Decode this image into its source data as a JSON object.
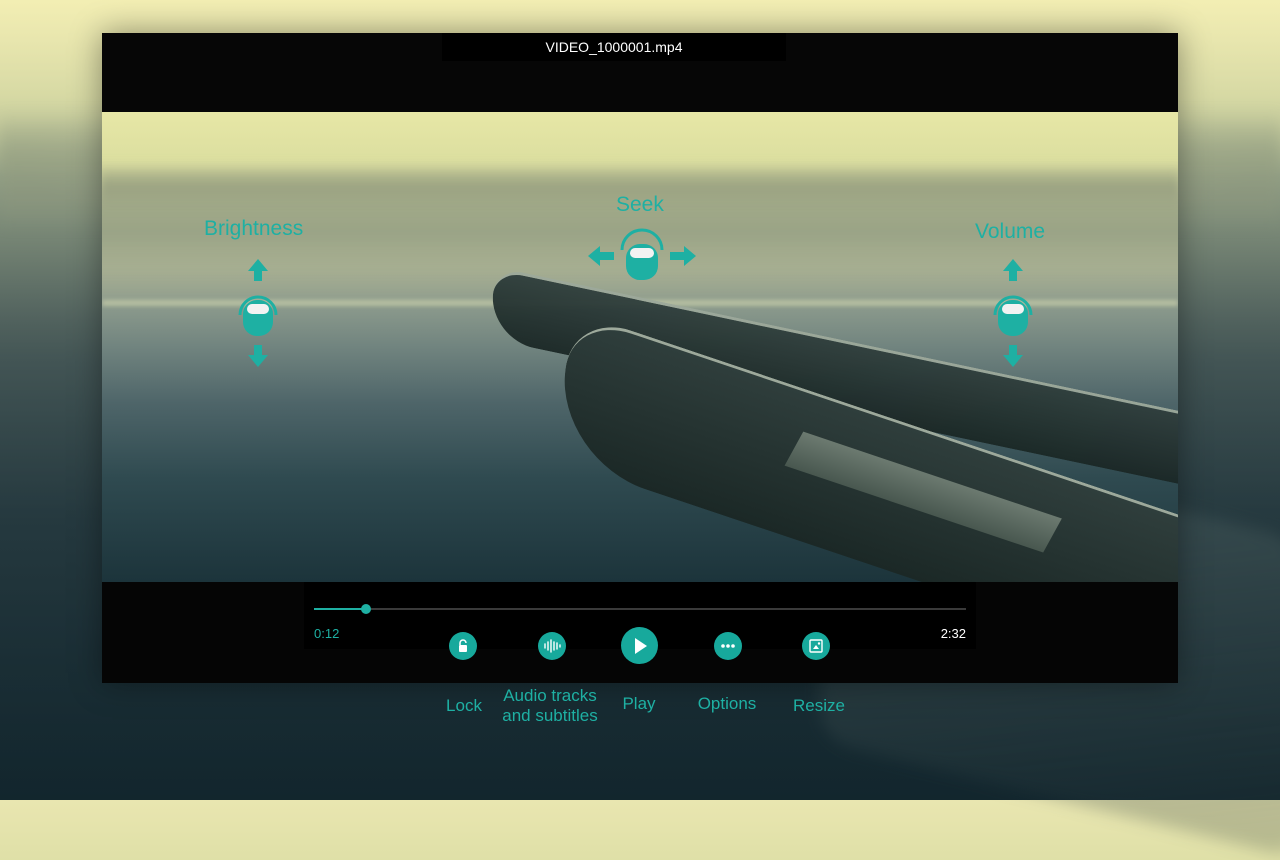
{
  "player": {
    "title": "VIDEO_1000001.mp4"
  },
  "gestures": {
    "brightness": "Brightness",
    "seek": "Seek",
    "volume": "Volume"
  },
  "seekbar": {
    "current_time": "0:12",
    "total_time": "2:32",
    "progress_fraction": 0.08
  },
  "controls": [
    {
      "icon": "lock-icon",
      "caption": "Lock"
    },
    {
      "icon": "audio-waveform-icon",
      "caption_line1": "Audio tracks",
      "caption_line2": "and subtitles"
    },
    {
      "icon": "play-icon",
      "caption": "Play"
    },
    {
      "icon": "more-options-icon",
      "caption": "Options"
    },
    {
      "icon": "resize-icon",
      "caption": "Resize"
    }
  ],
  "colors": {
    "accent": "#1eb0a3",
    "bar_background": "#050505"
  }
}
